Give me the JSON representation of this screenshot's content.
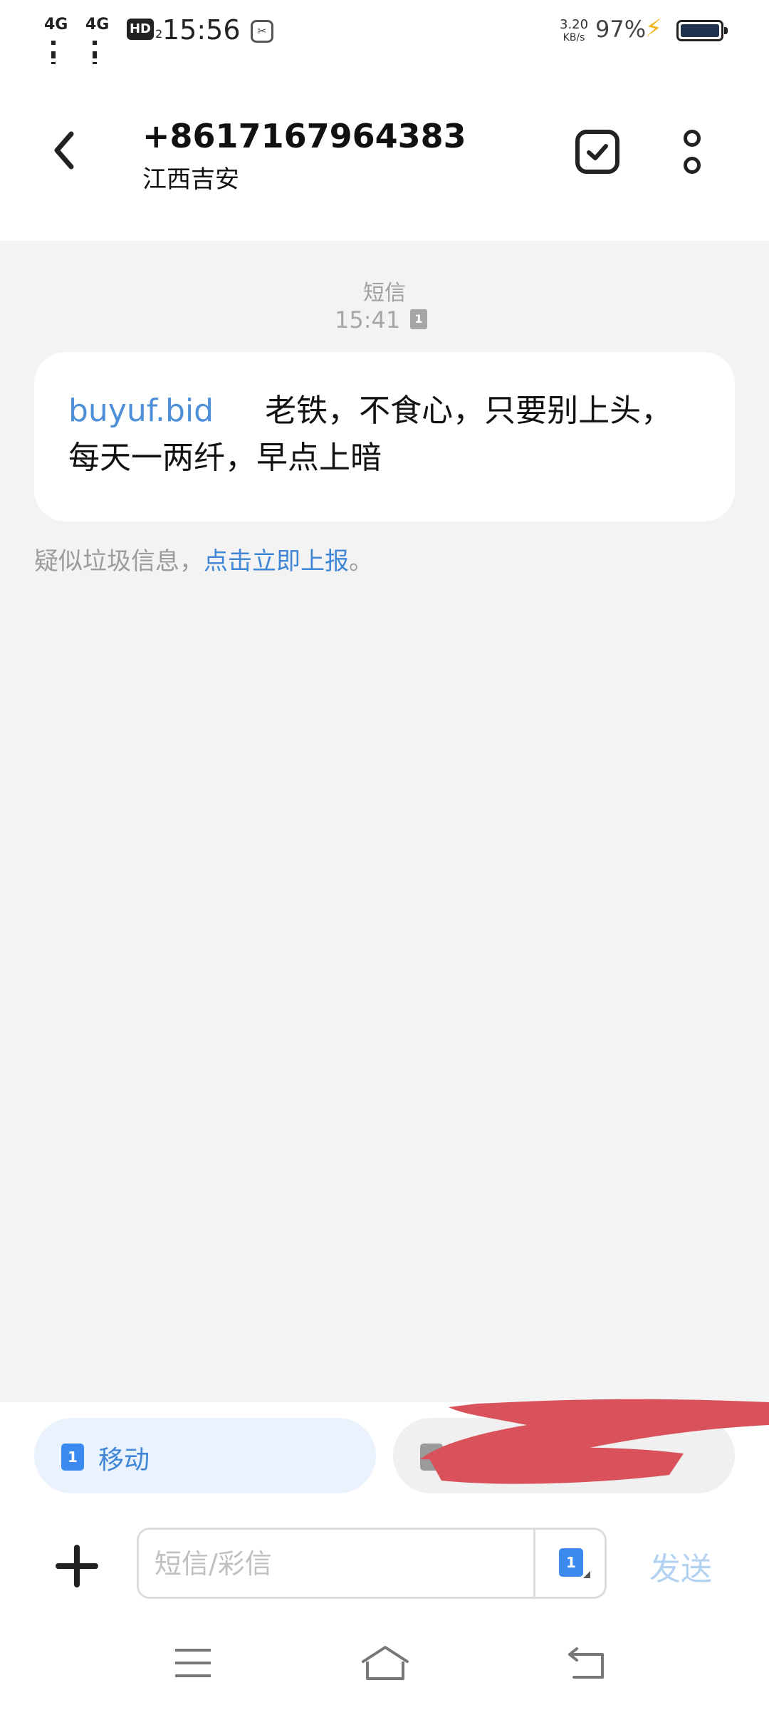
{
  "status_bar": {
    "signal1": "4G",
    "signal2": "4G",
    "hd": "HD",
    "hd_sub": "2",
    "time": "15:56",
    "net_speed_value": "3.20",
    "net_speed_unit": "KB/s",
    "battery": "97%",
    "battery_level": 0.97,
    "charging": true
  },
  "header": {
    "phone_number": "+8617167964383",
    "location": "江西吉安"
  },
  "conversation": {
    "message_type": "短信",
    "time": "15:41",
    "sim_indicator": "1",
    "message": {
      "link": "buyuf.bid",
      "text": "老铁，不食心，只要别上头，每天一两纤，早点上暗"
    },
    "spam_notice": {
      "prefix": "疑似垃圾信息，",
      "link": "点击立即上报",
      "suffix": "。"
    }
  },
  "sim_chooser": {
    "sim1_number": "1",
    "sim1_label": "移动"
  },
  "composer": {
    "placeholder": "短信/彩信",
    "sim_number": "1",
    "send_label": "发送"
  },
  "colors": {
    "accent": "#3f86d6",
    "link": "#4d8fd9",
    "background": "#f3f3f3",
    "scribble": "#d9525b"
  }
}
